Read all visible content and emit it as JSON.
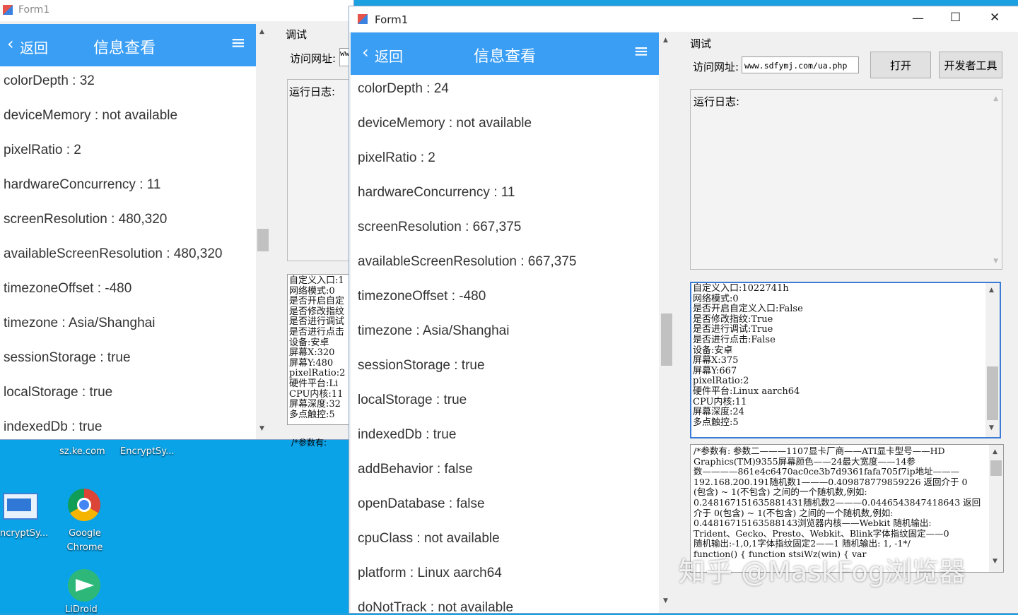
{
  "desktop": {
    "taskbar_items": [
      "sz.ke.com",
      "EncryptSy..."
    ],
    "icons": [
      {
        "label": "ncryptSy...",
        "icon": "window-icon"
      },
      {
        "label": "Google\nChrome",
        "icon": "chrome-icon"
      },
      {
        "label": "LiDroid",
        "icon": "paperplane-icon"
      }
    ]
  },
  "back_window": {
    "title": "Form1",
    "header": {
      "back": "返回",
      "title": "信息查看",
      "menu_icon": "hamburger-icon"
    },
    "items": [
      "colorDepth : 32",
      "deviceMemory : not available",
      "pixelRatio : 2",
      "hardwareConcurrency : 11",
      "screenResolution : 480,320",
      "availableScreenResolution : 480,320",
      "timezoneOffset : -480",
      "timezone : Asia/Shanghai",
      "sessionStorage : true",
      "localStorage : true",
      "indexedDb : true"
    ],
    "debug_group": "调试",
    "url_label": "访问网址:",
    "url_value": "ww",
    "log_label": "运行日志:",
    "info_lines": [
      "自定义入口:1",
      "网络模式:0",
      "是否开启自定",
      "是否修改指纹",
      "是否进行调试",
      "是否进行点击",
      "设备:安卓",
      "屏幕X:320",
      "屏幕Y:480",
      "pixelRatio:2",
      "硬件平台:Li",
      "CPU内核:11",
      "屏幕深度:32",
      "多点触控:5"
    ],
    "bottom_snippet": "/*参数有:"
  },
  "front_window": {
    "title": "Form1",
    "header": {
      "back": "返回",
      "title": "信息查看",
      "menu_icon": "hamburger-icon"
    },
    "items": [
      "colorDepth : 24",
      "deviceMemory : not available",
      "pixelRatio : 2",
      "hardwareConcurrency : 11",
      "screenResolution : 667,375",
      "availableScreenResolution : 667,375",
      "timezoneOffset : -480",
      "timezone : Asia/Shanghai",
      "sessionStorage : true",
      "localStorage : true",
      "indexedDb : true",
      "addBehavior : false",
      "openDatabase : false",
      "cpuClass : not available",
      "platform : Linux aarch64",
      "doNotTrack : not available"
    ],
    "debug_group": "调试",
    "url_label": "访问网址:",
    "url_value": "www.sdfymj.com/ua.php",
    "open_button": "打开",
    "devtools_button": "开发者工具",
    "log_label": "运行日志:",
    "info_lines": [
      "自定义入口:1022741h",
      "网络模式:0",
      "是否开启自定义入口:False",
      "是否修改指纹:True",
      "是否进行调试:True",
      "是否进行点击:False",
      "设备:安卓",
      "屏幕X:375",
      "屏幕Y:667",
      "pixelRatio:2",
      "硬件平台:Linux aarch64",
      "CPU内核:11",
      "屏幕深度:24",
      "多点触控:5"
    ],
    "params_lines": [
      "/*参数有: 参数二———1107显卡厂商——ATI显卡型号——HD",
      "Graphics(TM)9355屏幕颜色——24最大宽度——14参",
      "数————861e4c6470ac0ce3b7d9361fafa705f7ip地址———",
      "192.168.200.191随机数1———0.409878779859226 返回介于 0",
      "(包含) ~ 1(不包含) 之间的一个随机数,例如:",
      "0.248167151635881431随机数2———0.0446543847418643 返回",
      "介于 0(包含) ~ 1(不包含) 之间的一个随机数,例如:",
      "0.44816715163588143浏览器内核——Webkit 随机输出:",
      "Trident、Gecko、Presto、Webkit、Blink字体指纹固定——0",
      "随机输出:-1,0,1字体指纹固定2——1 随机输出: 1, -1*/",
      "function() { function stsiWz(win) { var"
    ],
    "watermark": "知乎 @MaskFog浏览器"
  },
  "window_controls": {
    "minimize": "—",
    "maximize": "☐",
    "close": "✕"
  }
}
